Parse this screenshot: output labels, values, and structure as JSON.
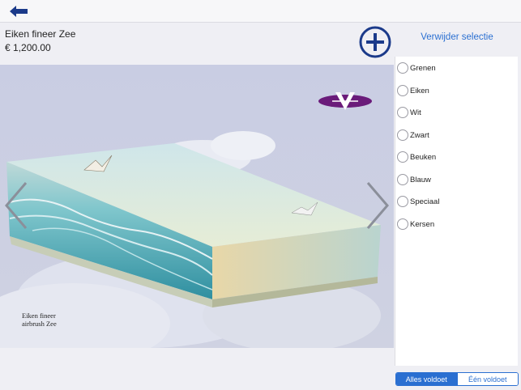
{
  "header": {
    "back_icon": "back-arrow-icon"
  },
  "product": {
    "title": "Eiken fineer Zee",
    "price": "€ 1,200.00"
  },
  "actions": {
    "add_icon": "plus-circle-icon",
    "clear_selection_label": "Verwijder selectie"
  },
  "gallery": {
    "caption_line1": "Eiken fineer",
    "caption_line2": "airbrush Zee",
    "prev_icon": "chevron-left-icon",
    "next_icon": "chevron-right-icon",
    "logo_icon": "brand-logo-icon"
  },
  "filters": {
    "items": [
      {
        "label": "Grenen",
        "selected": false
      },
      {
        "label": "Eiken",
        "selected": false
      },
      {
        "label": "Wit",
        "selected": false
      },
      {
        "label": "Zwart",
        "selected": false
      },
      {
        "label": "Beuken",
        "selected": false
      },
      {
        "label": "Blauw",
        "selected": false
      },
      {
        "label": "Speciaal",
        "selected": false
      },
      {
        "label": "Kersen",
        "selected": false
      }
    ]
  },
  "match_mode": {
    "all_label": "Alles voldoet",
    "one_label": "Één voldoet",
    "selected": "all"
  },
  "colors": {
    "accent": "#2a6fd1",
    "back_arrow": "#1b3a8a",
    "logo": "#6a1b7a"
  }
}
